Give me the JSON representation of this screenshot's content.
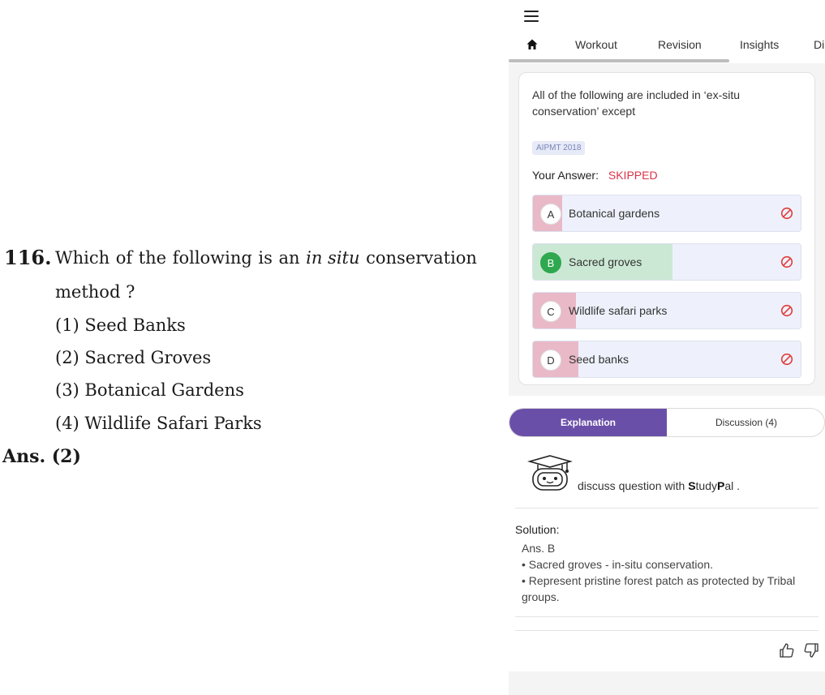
{
  "question_scan": {
    "number": "116.",
    "text_words": [
      "Which",
      "of",
      "the",
      "following",
      "is",
      "an",
      "in situ",
      "conservation"
    ],
    "text_line2": "method ?",
    "options": [
      "(1)  Seed Banks",
      "(2)  Sacred Groves",
      "(3)  Botanical Gardens",
      "(4)  Wildlife Safari Parks"
    ],
    "answer": "Ans.  (2)"
  },
  "nav": {
    "tabs": [
      {
        "label": "Workout"
      },
      {
        "label": "Revision"
      },
      {
        "label": "Insights"
      },
      {
        "label": "Di"
      }
    ],
    "home_icon": "home-icon",
    "menu_icon": "hamburger-menu-icon"
  },
  "question_card": {
    "text": "All of the following are included in ‘ex-situ conservation’ except",
    "tag": "AIPMT 2018",
    "your_answer_label": "Your Answer:",
    "your_answer_status": "SKIPPED",
    "options": [
      {
        "letter": "A",
        "label": "Botanical gardens",
        "state": "wrong",
        "response_share": 0.11
      },
      {
        "letter": "B",
        "label": "Sacred groves",
        "state": "correct",
        "response_share": 0.52
      },
      {
        "letter": "C",
        "label": "Wildlife safari parks",
        "state": "wrong",
        "response_share": 0.16
      },
      {
        "letter": "D",
        "label": "Seed banks",
        "state": "wrong",
        "response_share": 0.17
      }
    ]
  },
  "switcher": {
    "explanation": "Explanation",
    "discussion": "Discussion (4)"
  },
  "studypal": {
    "prefix": "discuss question with ",
    "s": "S",
    "tudy": "tudy",
    "p": "P",
    "al": "al ."
  },
  "solution": {
    "heading": "Solution:",
    "lines": [
      "Ans. B",
      "• Sacred groves - in-situ conservation.",
      "• Represent pristine forest patch as protected by Tribal groups."
    ]
  },
  "colors": {
    "accent": "#6a4fa8",
    "wrong": "#e9b9c8",
    "correct": "#cbe8d4",
    "skipped": "#d9344a",
    "correct_letter": "#2fa84f"
  }
}
